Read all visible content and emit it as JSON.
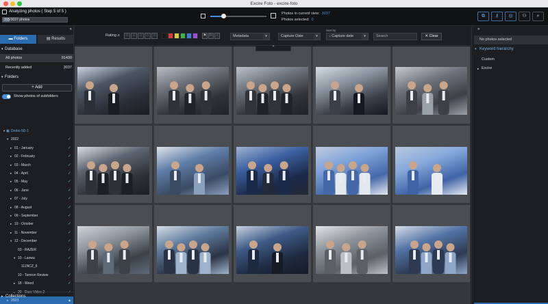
{
  "window": {
    "title": "Excire Foto - excire-foto"
  },
  "header": {
    "progress_title": "Analyzing photos ( Step 5 of 5 )",
    "progress_text": "315/3037 photos",
    "progress_fraction": 0.104,
    "zoom_fraction": 0.23,
    "photos_in_view_label": "Photos in current view:",
    "photos_in_view_value": "3037",
    "photos_selected_label": "Photos selected:",
    "photos_selected_value": "0",
    "buttons": [
      "copy-icon",
      "keyword-icon",
      "target-icon",
      "people-icon",
      "search-icon"
    ]
  },
  "left": {
    "collapse": "«",
    "tab_folders": "Folders",
    "tab_results": "Results",
    "database_header": "Database",
    "all_photos_label": "All photos",
    "all_photos_count": "91430",
    "recent_label": "Recently added",
    "recent_count": "3037",
    "folders_header": "Folders",
    "add_label": "+ Add",
    "show_subfolders": "Show photos of subfolders",
    "tree": [
      {
        "label": "Drobo 5D-1",
        "tri": "▾",
        "indent": 1,
        "check": false
      },
      {
        "label": "2022",
        "tri": "▾",
        "indent": 2,
        "check": true
      },
      {
        "label": "01 - January",
        "tri": "▸",
        "indent": 3,
        "check": true
      },
      {
        "label": "02 - February",
        "tri": "▸",
        "indent": 3,
        "check": true
      },
      {
        "label": "03 - March",
        "tri": "▸",
        "indent": 3,
        "check": true
      },
      {
        "label": "04 - April",
        "tri": "▸",
        "indent": 3,
        "check": true
      },
      {
        "label": "05 - May",
        "tri": "▸",
        "indent": 3,
        "check": true
      },
      {
        "label": "06 - June",
        "tri": "▸",
        "indent": 3,
        "check": true
      },
      {
        "label": "07 - July",
        "tri": "▸",
        "indent": 3,
        "check": true
      },
      {
        "label": "08 - August",
        "tri": "▸",
        "indent": 3,
        "check": true
      },
      {
        "label": "09 - September",
        "tri": "▸",
        "indent": 3,
        "check": true
      },
      {
        "label": "10 - October",
        "tri": "▸",
        "indent": 3,
        "check": true
      },
      {
        "label": "11 - November",
        "tri": "▸",
        "indent": 3,
        "check": true
      },
      {
        "label": "12 - December",
        "tri": "▾",
        "indent": 3,
        "check": true
      },
      {
        "label": "03 - RAZER",
        "tri": "",
        "indent": 4,
        "check": true
      },
      {
        "label": "10 - Laowa",
        "tri": "▾",
        "indent": 4,
        "check": true
      },
      {
        "label": "111NCZ_6",
        "tri": "",
        "indent": 5,
        "check": true
      },
      {
        "label": "10 - Tamron Review",
        "tri": "",
        "indent": 4,
        "check": true
      },
      {
        "label": "18 - Weed",
        "tri": "▸",
        "indent": 4,
        "check": true
      },
      {
        "label": "20 - Dare Video 2",
        "tri": "▸",
        "indent": 4,
        "check": true
      },
      {
        "label": "2023",
        "tri": "▸",
        "indent": 2,
        "check": false,
        "selected": true
      }
    ],
    "collections": "Collections"
  },
  "toolbar": {
    "rating_label": "Rating ≥",
    "metadata": "Metadata",
    "capture_date": "Capture Date",
    "sort_by": "Sort by",
    "sort_value": "↓ Capture date",
    "search_placeholder": "Search",
    "clear_label": "✕ Clear",
    "up_arrow": "⌃"
  },
  "colors": {
    "accent": "#2b6cb0",
    "swatches": [
      "#1a1a1a",
      "#d63a3a",
      "#e0c93a",
      "#3fb04a",
      "#3a7fd6",
      "#9a4fd0"
    ]
  },
  "photos": [
    {
      "name": "camera-booth"
    },
    {
      "name": "two-men-interview"
    },
    {
      "name": "two-men-interview-2"
    },
    {
      "name": "woman-at-booth"
    },
    {
      "name": "hallway-visitors"
    },
    {
      "name": "men-conversation"
    },
    {
      "name": "group-at-booth"
    },
    {
      "name": "harman-booth"
    },
    {
      "name": "group-smiling"
    },
    {
      "name": "group-smiling-2"
    },
    {
      "name": "man-interview-car"
    },
    {
      "name": "man-in-suit-booth"
    },
    {
      "name": "tripod-crowd"
    },
    {
      "name": "man-in-showroom"
    },
    {
      "name": "crowd-event"
    }
  ],
  "right": {
    "collapse": "»",
    "no_photos": "No photos selected",
    "keyword_header": "Keyword hierarchy",
    "custom": "Custom",
    "excire": "Excire"
  }
}
